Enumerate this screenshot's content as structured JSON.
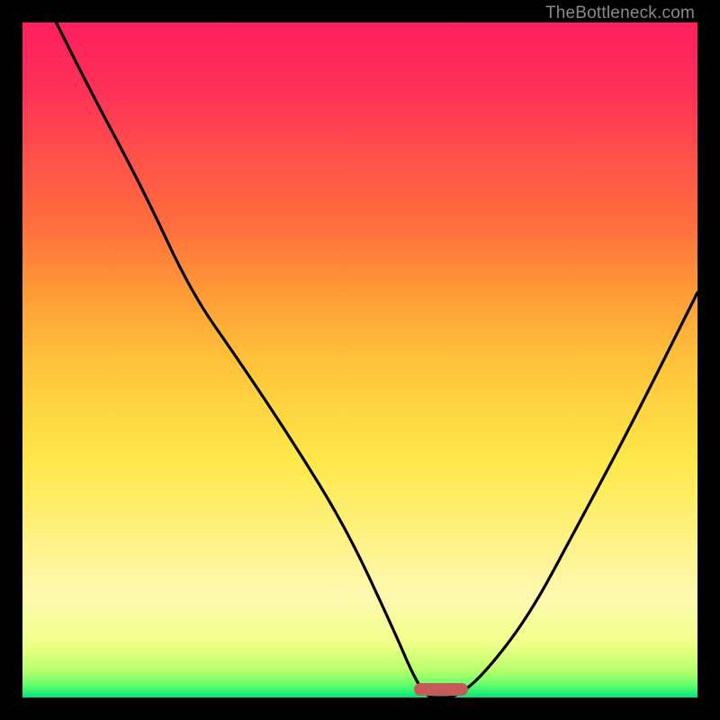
{
  "attribution": "TheBottleneck.com",
  "colors": {
    "frame": "#000000",
    "marker": "#c75a59",
    "curve_stroke": "#000000",
    "gradient_stops": [
      "#00e676",
      "#6bff6b",
      "#b8ff6b",
      "#f0ff89",
      "#fff9b0",
      "#ffe84a",
      "#ffc23a",
      "#ff9a36",
      "#ff6e3d",
      "#ff514a",
      "#ff3157",
      "#ff1f5f"
    ]
  },
  "chart_data": {
    "type": "line",
    "title": "",
    "xlabel": "",
    "ylabel": "",
    "xlim": [
      0,
      100
    ],
    "ylim": [
      0,
      100
    ],
    "x": [
      5,
      10,
      18,
      25,
      32,
      40,
      48,
      55,
      58,
      60,
      62,
      64,
      68,
      75,
      82,
      90,
      100
    ],
    "values": [
      100,
      90,
      75,
      60,
      50,
      38,
      25,
      10,
      3,
      0,
      0,
      0,
      3,
      12,
      25,
      40,
      60
    ],
    "minimum_at_x": 62,
    "minimum_marker": {
      "x_start": 58,
      "x_end": 66,
      "y": 0
    }
  }
}
